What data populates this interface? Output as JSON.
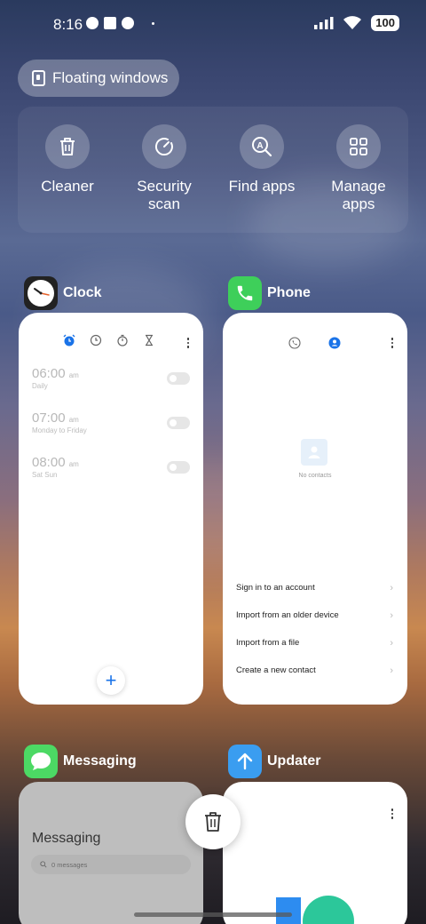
{
  "status_bar": {
    "time": "8:16",
    "battery": "100"
  },
  "floating_windows": {
    "label": "Floating windows"
  },
  "quick_actions": [
    {
      "label": "Cleaner",
      "icon": "trash-icon"
    },
    {
      "label": "Security\nscan",
      "icon": "gauge-icon"
    },
    {
      "label": "Find apps",
      "icon": "search-a-icon"
    },
    {
      "label": "Manage\napps",
      "icon": "grid-icon"
    }
  ],
  "recent_apps": {
    "clock": {
      "name": "Clock",
      "alarms": [
        {
          "time": "06:00",
          "ampm": "am",
          "repeat": "Daily"
        },
        {
          "time": "07:00",
          "ampm": "am",
          "repeat": "Monday to Friday"
        },
        {
          "time": "08:00",
          "ampm": "am",
          "repeat": "Sat Sun"
        }
      ],
      "fab": "+"
    },
    "phone": {
      "name": "Phone",
      "empty_text": "No contacts",
      "actions": [
        "Sign in to an account",
        "Import from an older device",
        "Import from a file",
        "Create a new contact"
      ]
    },
    "messaging": {
      "name": "Messaging",
      "title": "Messaging",
      "search_placeholder": "0 messages"
    },
    "updater": {
      "name": "Updater"
    }
  },
  "colors": {
    "accent_blue": "#1a73e8",
    "phone_green": "#3ecf5a",
    "messaging_green": "#4cd964",
    "updater_blue": "#3a9df0"
  }
}
